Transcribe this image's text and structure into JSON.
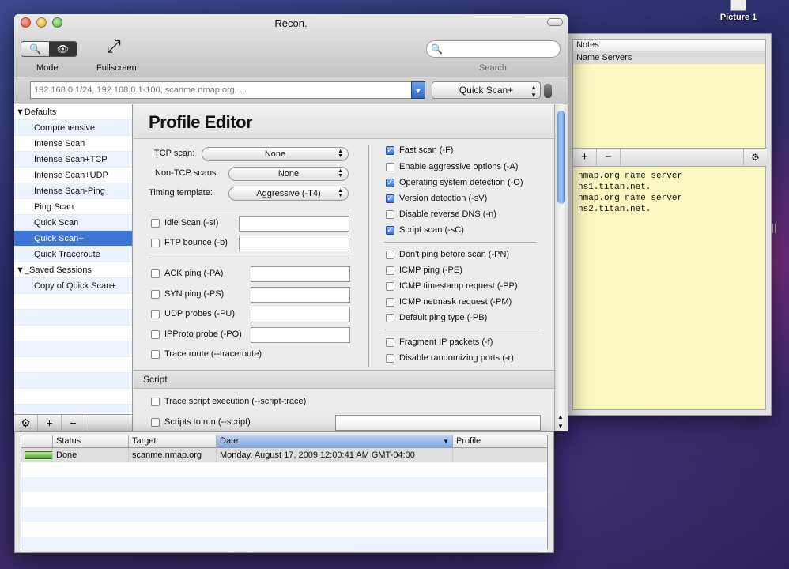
{
  "desktop": {
    "icon_label": "Picture 1"
  },
  "window": {
    "title": "Recon."
  },
  "toolbar": {
    "mode_label": "Mode",
    "fullscreen_label": "Fullscreen",
    "search_label": "Search",
    "search_placeholder": ""
  },
  "target": {
    "value": "192.168.0.1/24, 192.168.0.1-100, scanme.nmap.org, ...",
    "profile": "Quick Scan+"
  },
  "sidebar": {
    "groups": [
      {
        "label": "Defaults",
        "items": [
          "Comprehensive",
          "Intense Scan",
          "Intense Scan+TCP",
          "Intense Scan+UDP",
          "Intense Scan-Ping",
          "Ping Scan",
          "Quick Scan",
          "Quick Scan+",
          "Quick Traceroute"
        ]
      },
      {
        "label": "_Saved Sessions",
        "items": [
          "Copy of Quick Scan+"
        ]
      }
    ],
    "selected": "Quick Scan+"
  },
  "editor": {
    "title": "Profile Editor",
    "tcp_scan_label": "TCP scan:",
    "tcp_scan_value": "None",
    "nontcp_label": "Non-TCP scans:",
    "nontcp_value": "None",
    "timing_label": "Timing template:",
    "timing_value": "Aggressive (-T4)",
    "left_checks": [
      {
        "label": "Idle Scan (-sI)",
        "checked": false
      },
      {
        "label": "FTP bounce (-b)",
        "checked": false
      },
      {
        "label": "ACK ping (-PA)",
        "checked": false
      },
      {
        "label": "SYN ping (-PS)",
        "checked": false
      },
      {
        "label": "UDP probes (-PU)",
        "checked": false
      },
      {
        "label": "IPProto probe (-PO)",
        "checked": false
      },
      {
        "label": "Trace route (--traceroute)",
        "checked": false
      }
    ],
    "right_checks": [
      {
        "label": "Fast scan (-F)",
        "checked": true
      },
      {
        "label": "Enable aggressive options (-A)",
        "checked": false
      },
      {
        "label": "Operating system detection (-O)",
        "checked": true
      },
      {
        "label": "Version detection (-sV)",
        "checked": true
      },
      {
        "label": "Disable reverse DNS (-n)",
        "checked": false
      },
      {
        "label": "Script scan (-sC)",
        "checked": true
      },
      {
        "label": "Don't ping before scan (-PN)",
        "checked": false
      },
      {
        "label": "ICMP ping (-PE)",
        "checked": false
      },
      {
        "label": "ICMP timestamp request (-PP)",
        "checked": false
      },
      {
        "label": "ICMP netmask request (-PM)",
        "checked": false
      },
      {
        "label": "Default ping type (-PB)",
        "checked": false
      },
      {
        "label": "Fragment IP packets (-f)",
        "checked": false
      },
      {
        "label": "Disable randomizing ports (-r)",
        "checked": false
      }
    ],
    "script_section": "Script",
    "script_checks": [
      {
        "label": "Trace script execution (--script-trace)",
        "checked": false
      },
      {
        "label": "Scripts to run (--script)",
        "checked": false
      }
    ]
  },
  "sidebar_bar": {
    "gear": "⚙",
    "add": "+",
    "remove": "−"
  },
  "notes": {
    "header": "Notes",
    "row": "Name Servers",
    "add": "+",
    "remove": "−",
    "gear": "⚙",
    "text": "nmap.org name server\nns1.titan.net.\nnmap.org name server\nns2.titan.net."
  },
  "history": {
    "columns": [
      "Status",
      "Target",
      "Date",
      "Profile"
    ],
    "rows": [
      {
        "status": "Done",
        "target": "scanme.nmap.org",
        "date": "Monday, August 17, 2009 12:00:41 AM GMT-04:00",
        "profile": ""
      }
    ]
  }
}
